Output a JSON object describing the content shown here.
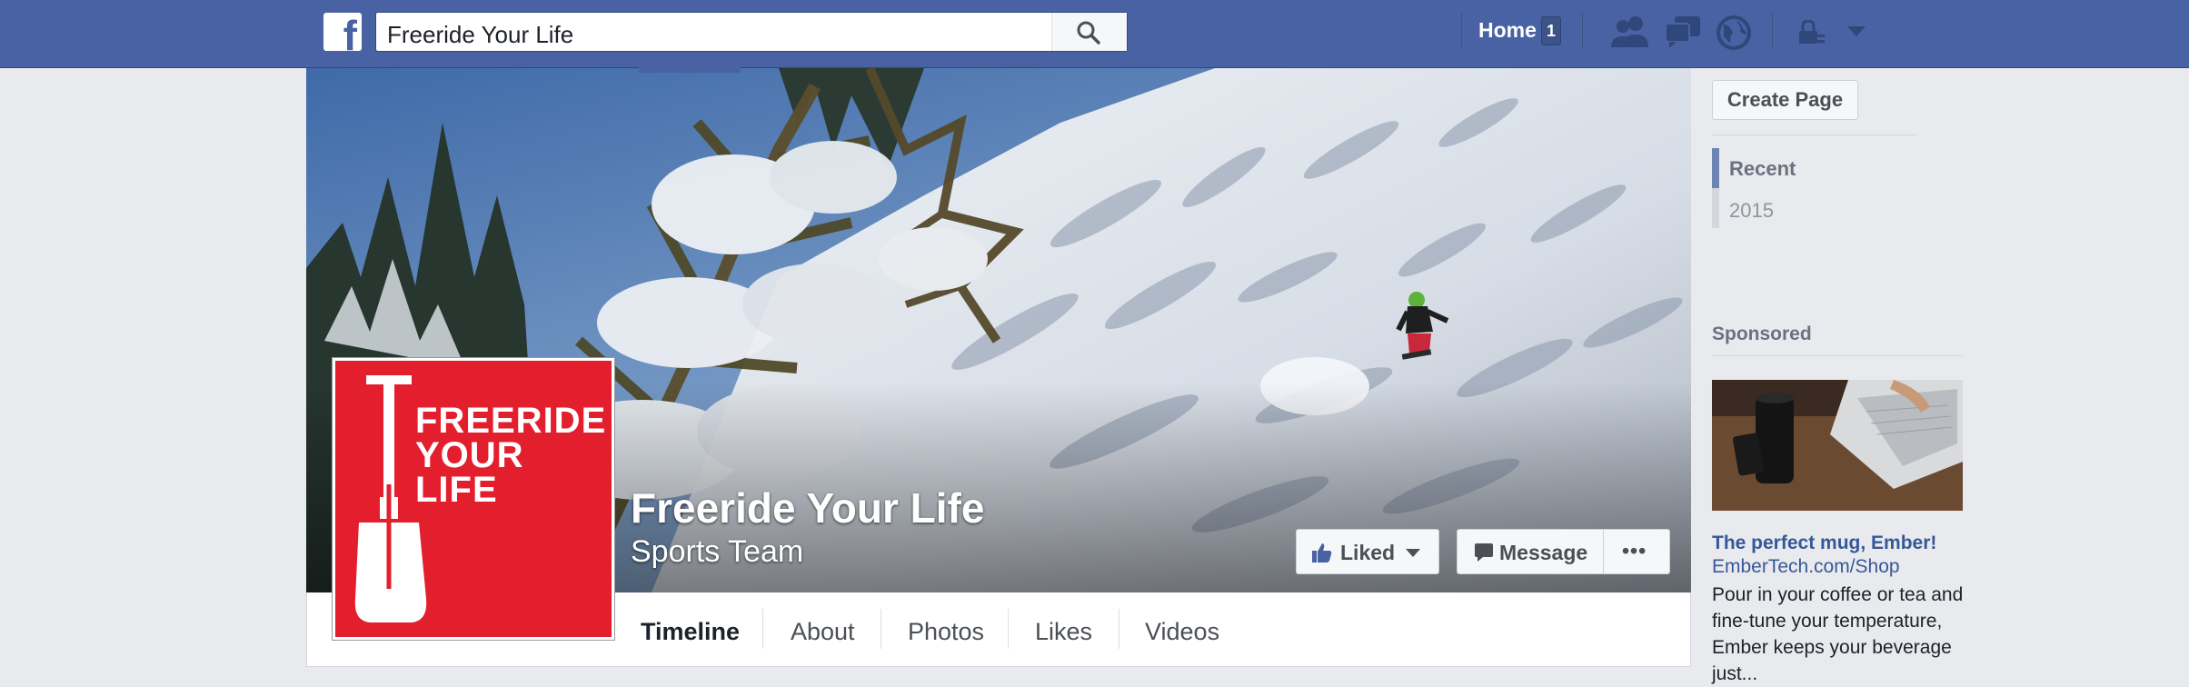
{
  "topbar": {
    "logo": "f",
    "search_value": "Freeride Your Life",
    "home_label": "Home",
    "home_badge": "1",
    "icons": [
      "search-icon",
      "friends-icon",
      "messages-icon",
      "notifications-globe-icon",
      "privacy-lock-icon",
      "chevron-down-icon"
    ]
  },
  "page": {
    "name": "Freeride Your Life",
    "category": "Sports Team",
    "profile_logo": {
      "line1": "FREERIDE",
      "line2": "YOUR",
      "line3": "LIFE"
    }
  },
  "actions": {
    "liked_label": "Liked",
    "message_label": "Message",
    "more_label": "•••"
  },
  "tabs": [
    {
      "label": "Timeline",
      "active": true
    },
    {
      "label": "About",
      "active": false
    },
    {
      "label": "Photos",
      "active": false
    },
    {
      "label": "Likes",
      "active": false
    },
    {
      "label": "Videos",
      "active": false
    }
  ],
  "right_column": {
    "create_page_label": "Create Page",
    "timeline_nav": {
      "recent_label": "Recent",
      "year_label": "2015"
    },
    "sponsored_label": "Sponsored",
    "ad": {
      "title": "The perfect mug, Ember!",
      "url": "EmberTech.com/Shop",
      "body": "Pour in your coffee or tea and fine-tune your temperature, Ember keeps your beverage just..."
    }
  },
  "colors": {
    "brand_blue": "#4862a3",
    "logo_red": "#e31f2e",
    "background": "#e9eaed"
  }
}
